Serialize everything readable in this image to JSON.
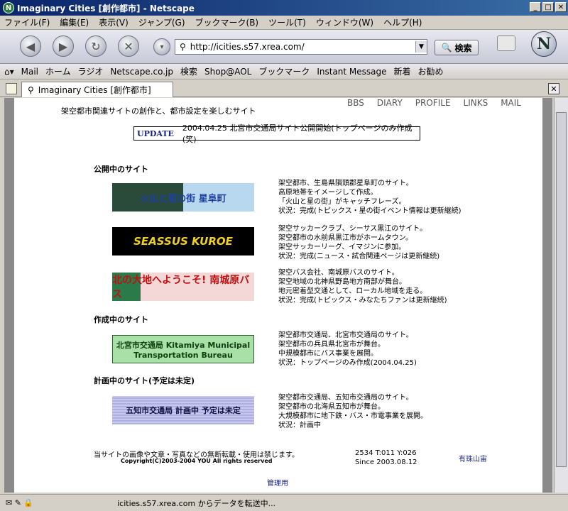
{
  "window": {
    "title": "Imaginary Cities [創作都市] - Netscape"
  },
  "menu": [
    "ファイル(F)",
    "編集(E)",
    "表示(V)",
    "ジャンプ(G)",
    "ブックマーク(B)",
    "ツール(T)",
    "ウィンドウ(W)",
    "ヘルプ(H)"
  ],
  "nav": {
    "url": "http://icities.s57.xrea.com/",
    "search_label": "検索"
  },
  "bookmarks": [
    "Mail",
    "ホーム",
    "ラジオ",
    "Netscape.co.jp",
    "検索",
    "Shop@AOL",
    "ブックマーク",
    "Instant Message",
    "新着",
    "お勧め"
  ],
  "tab": {
    "label": "Imaginary Cities [創作都市]"
  },
  "page": {
    "nav_links": [
      "BBS",
      "DIARY",
      "PROFILE",
      "LINKS",
      "MAIL"
    ],
    "subtitle": "架空都市関連サイトの創作と、都市設定を楽しむサイト",
    "update": {
      "label": "UPDATE",
      "text": "2004.04.25  北宮市交通局サイト公開開始(トップページのみ作成(笑)"
    },
    "sections": [
      {
        "heading": "公開中のサイト",
        "sites": [
          {
            "banner": "火山と星の街 星阜町",
            "lines": [
              "架空都市、生島県隕頭郡星阜町のサイト。",
              "高原地帯をイメージして作成。",
              "「火山と星の街」がキャッチフレーズ。",
              "状況：完成(トピックス・星の街イベント情報は更新継続)"
            ]
          },
          {
            "banner": "SEASSUS KUROE",
            "lines": [
              "架空サッカークラブ、シーサス黒江のサイト。",
              "架空都市の水前県黒江市がホームタウン。",
              "架空サッカーリーグ、イマジンに参加。",
              "状況：完成(ニュース・試合関連ページは更新継続)"
            ]
          },
          {
            "banner": "北の大地へようこそ! 南城原バス",
            "lines": [
              "架空バス会社、南城原バスのサイト。",
              "架空地域の北神県野島地方南部が舞台。",
              "地元密着型交通として、ローカル地域を走る。",
              "状況：完成(トピックス・みなたちファンは更新継続)"
            ]
          }
        ]
      },
      {
        "heading": "作成中のサイト",
        "sites": [
          {
            "banner": "北宮市交通局 Kitamiya Municipal Transportation Bureau",
            "lines": [
              "架空都市交通局、北宮市交通局のサイト。",
              "架空都市の兵具県北宮市が舞台。",
              "中規模都市にバス事業を展開。",
              "状況：トップページのみ作成(2004.04.25)"
            ]
          }
        ]
      },
      {
        "heading": "計画中のサイト(予定は未定)",
        "sites": [
          {
            "banner": "五知市交通局 計画中 予定は未定",
            "lines": [
              "架空都市交通局、五知市交通局のサイト。",
              "架空都市の北海県五知市が舞台。",
              "大規模都市に地下鉄・バス・市電事業を展開。",
              "状況：計画中"
            ]
          }
        ]
      }
    ],
    "footer": {
      "notice": "当サイトの画像や文章・写真などの無断転載・使用は禁じます。",
      "copyright": "Copyright(C)2003-2004 YOU All rights reserved",
      "counter": "2534 T:011 Y:026",
      "since": "Since 2003.08.12",
      "right_link": "有珠山宙",
      "admin": "管理用"
    }
  },
  "status": {
    "text": "icities.s57.xrea.com からデータを転送中..."
  }
}
